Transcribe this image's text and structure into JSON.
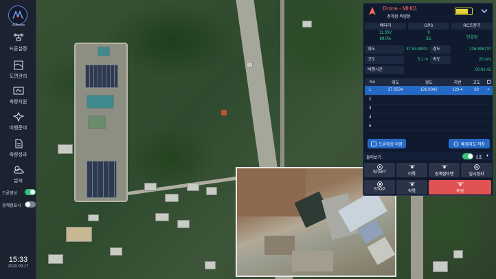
{
  "sidebar": {
    "logo_text": "AIDrone",
    "items": [
      {
        "label": "드론설정",
        "icon": "drone-icon"
      },
      {
        "label": "도면관리",
        "icon": "map-icon"
      },
      {
        "label": "측량지원",
        "icon": "survey-icon"
      },
      {
        "label": "비행준비",
        "icon": "flight-prep-icon"
      },
      {
        "label": "측량성과",
        "icon": "document-icon"
      },
      {
        "label": "날씨",
        "icon": "weather-icon"
      }
    ],
    "toggles": [
      {
        "label": "드론영상",
        "on": true
      },
      {
        "label": "경계점표시",
        "on": false
      }
    ],
    "clock": {
      "time": "15:33",
      "date": "2020.09.17"
    }
  },
  "panel": {
    "drone_name": "Drone - MH01",
    "mode": "경계점 측량용",
    "battery_level": 0.75,
    "stats_headers": {
      "battery": "배터리",
      "gps": "GPS",
      "rc": "RC조종기"
    },
    "battery_voltage": "11.35V",
    "battery_percent": "99.0%",
    "gps_count": "9",
    "gps_fix": "3D",
    "rc_status": "연결됨",
    "latitude_label": "위도",
    "latitude_value": "37.5149001",
    "longitude_label": "경도",
    "longitude_value": "126.895737",
    "altitude_label": "고도",
    "altitude_value": "5.1 m",
    "speed_label": "속도",
    "speed_value": "20 m/s",
    "flight_time_label": "비행시간",
    "flight_time_value": "00:01:42",
    "waypoint_headers": [
      "No",
      "위도",
      "경도",
      "지번",
      "고도"
    ],
    "waypoints": [
      {
        "no": "1",
        "lat": "37.0534",
        "lon": "126.9342",
        "lot": "123-4",
        "alt": "30",
        "selected": true
      },
      {
        "no": "2",
        "lat": "",
        "lon": "",
        "lot": "",
        "alt": "",
        "selected": false
      },
      {
        "no": "3",
        "lat": "",
        "lon": "",
        "lot": "",
        "alt": "",
        "selected": false
      },
      {
        "no": "4",
        "lat": "",
        "lon": "",
        "lot": "",
        "alt": "",
        "selected": false
      },
      {
        "no": "5",
        "lat": "",
        "lon": "",
        "lot": "",
        "alt": "",
        "selected": false
      }
    ],
    "save_video_label": "드론영상 저장",
    "save_map_label": "배경지도 저장",
    "look_around_label": "둘러보기",
    "look_around_on": true,
    "interval_value": "5초",
    "buttons": {
      "start": "START",
      "move": "이륙",
      "boundary_flight": "경계점비행",
      "pause": "일시정지",
      "stop": "STOP",
      "land": "착륙",
      "return": "복귀"
    }
  },
  "colors": {
    "accent_blue": "#2569c6",
    "status_green": "#39d18b",
    "alert_red": "#e05352",
    "drone_name_red": "#ff6b5a",
    "battery_yellow": "#e8d33a"
  }
}
